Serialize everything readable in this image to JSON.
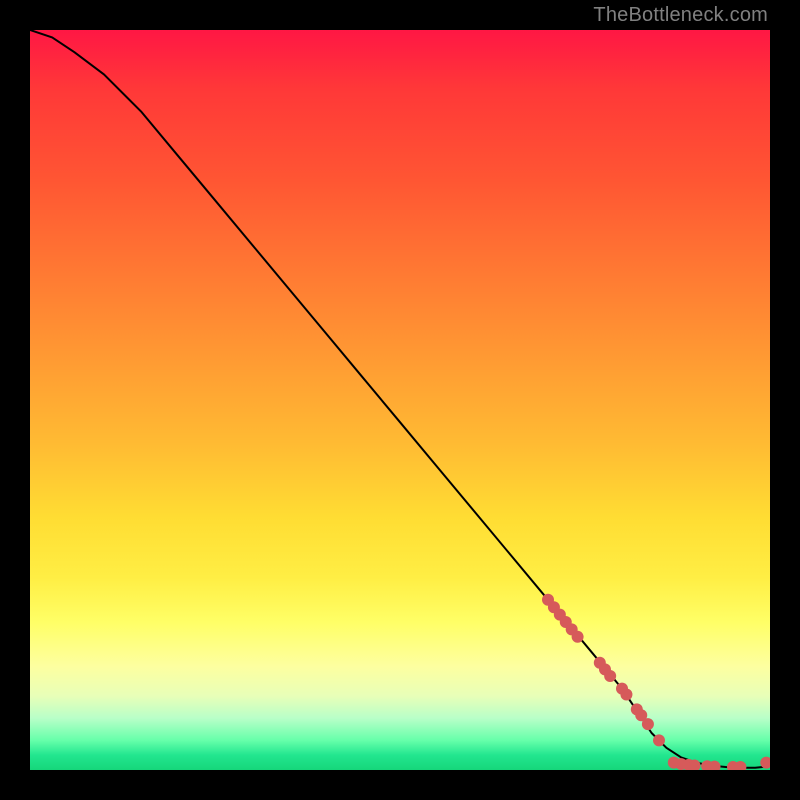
{
  "watermark": "TheBottleneck.com",
  "colors": {
    "background": "#000000",
    "gradient_top": "#ff1744",
    "gradient_mid": "#ffee44",
    "gradient_bottom": "#16d67a",
    "curve": "#000000",
    "marker": "#d65a5a"
  },
  "chart_data": {
    "type": "line",
    "title": "",
    "xlabel": "",
    "ylabel": "",
    "xlim": [
      0,
      100
    ],
    "ylim": [
      0,
      100
    ],
    "grid": false,
    "series": [
      {
        "name": "curve",
        "x": [
          0,
          3,
          6,
          10,
          15,
          20,
          25,
          30,
          35,
          40,
          45,
          50,
          55,
          60,
          65,
          70,
          75,
          80,
          84,
          86,
          88,
          90,
          92,
          94,
          96,
          98,
          99,
          100
        ],
        "y": [
          100,
          99,
          97,
          94,
          89,
          83,
          77,
          71,
          65,
          59,
          53,
          47,
          41,
          35,
          29,
          23,
          17,
          11,
          5,
          3,
          1.7,
          1.0,
          0.6,
          0.4,
          0.3,
          0.3,
          0.4,
          1.2
        ]
      }
    ],
    "markers": [
      {
        "x": 70.0,
        "y": 23.0
      },
      {
        "x": 70.8,
        "y": 22.0
      },
      {
        "x": 71.6,
        "y": 21.0
      },
      {
        "x": 72.4,
        "y": 20.0
      },
      {
        "x": 73.2,
        "y": 19.0
      },
      {
        "x": 74.0,
        "y": 18.0
      },
      {
        "x": 77.0,
        "y": 14.5
      },
      {
        "x": 77.7,
        "y": 13.6
      },
      {
        "x": 78.4,
        "y": 12.7
      },
      {
        "x": 80.0,
        "y": 11.0
      },
      {
        "x": 80.6,
        "y": 10.2
      },
      {
        "x": 82.0,
        "y": 8.2
      },
      {
        "x": 82.6,
        "y": 7.4
      },
      {
        "x": 83.5,
        "y": 6.2
      },
      {
        "x": 85.0,
        "y": 4.0
      },
      {
        "x": 87.0,
        "y": 1.0
      },
      {
        "x": 88.0,
        "y": 0.8
      },
      {
        "x": 89.0,
        "y": 0.7
      },
      {
        "x": 89.8,
        "y": 0.6
      },
      {
        "x": 91.5,
        "y": 0.5
      },
      {
        "x": 92.5,
        "y": 0.45
      },
      {
        "x": 95.0,
        "y": 0.4
      },
      {
        "x": 96.0,
        "y": 0.4
      },
      {
        "x": 99.5,
        "y": 1.0
      }
    ]
  }
}
